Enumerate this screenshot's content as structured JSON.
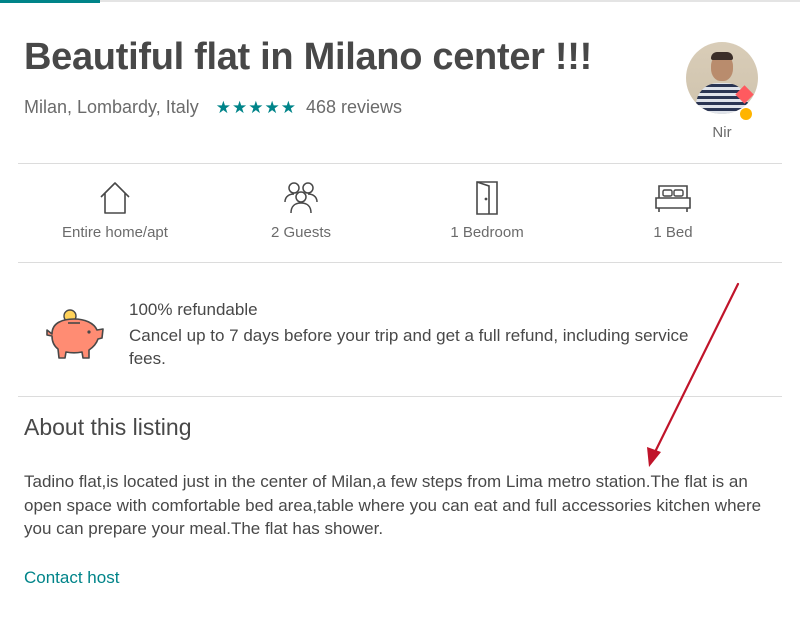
{
  "listing": {
    "title": "Beautiful flat in Milano center !!!",
    "location": "Milan, Lombardy, Italy",
    "stars": "★★★★★",
    "rating_stars": 5,
    "reviews_label": "468 reviews"
  },
  "host": {
    "name": "Nir"
  },
  "amenities": [
    {
      "icon": "house-icon",
      "label": "Entire home/apt"
    },
    {
      "icon": "guests-icon",
      "label": "2 Guests"
    },
    {
      "icon": "door-icon",
      "label": "1 Bedroom"
    },
    {
      "icon": "bed-icon",
      "label": "1 Bed"
    }
  ],
  "refund": {
    "icon": "piggy-bank-icon",
    "title": "100% refundable",
    "body": "Cancel up to 7 days before your trip and get a full refund, including service fees."
  },
  "about": {
    "heading": "About this listing",
    "text": "Tadino flat,is located just in the center of Milan,a few steps from Lima metro station.The flat is an open space with comfortable bed area,table where you can eat and full accessories kitchen where you can prepare your meal.The flat has shower."
  },
  "contact_host_label": "Contact host",
  "colors": {
    "accent": "#008489",
    "text": "#484848",
    "secondary_text": "#6b6b6b",
    "piggy": "#ff8c73",
    "annotation_arrow": "#c0142a",
    "badge_red": "#ff5a5f",
    "badge_yellow": "#ffb400"
  }
}
